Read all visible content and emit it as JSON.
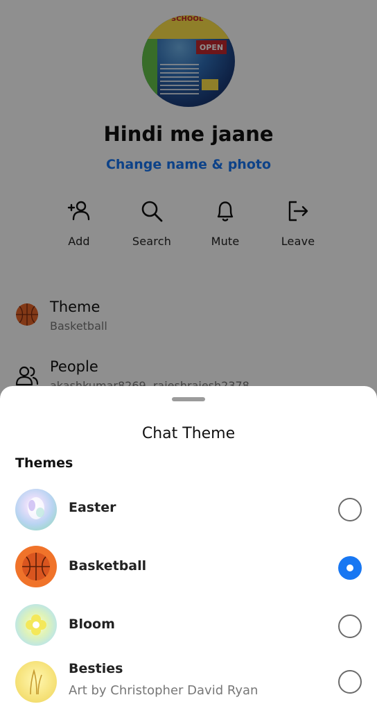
{
  "group": {
    "name": "Hindi me jaane",
    "change_link": "Change name & photo",
    "avatar_text": {
      "school": "SCHOOL",
      "open": "OPEN"
    }
  },
  "actions": [
    {
      "label": "Add",
      "icon": "add-person-icon"
    },
    {
      "label": "Search",
      "icon": "search-icon"
    },
    {
      "label": "Mute",
      "icon": "bell-icon"
    },
    {
      "label": "Leave",
      "icon": "leave-icon"
    }
  ],
  "settings": {
    "theme": {
      "title": "Theme",
      "value": "Basketball"
    },
    "people": {
      "title": "People",
      "value": "akashkumar8269, rajeshrajesh2378"
    }
  },
  "sheet": {
    "title": "Chat Theme",
    "section": "Themes",
    "themes": [
      {
        "name": "Easter",
        "subtitle": "",
        "selected": false
      },
      {
        "name": "Basketball",
        "subtitle": "",
        "selected": true
      },
      {
        "name": "Bloom",
        "subtitle": "",
        "selected": false
      },
      {
        "name": "Besties",
        "subtitle": "Art by Christopher David Ryan",
        "selected": false
      }
    ]
  },
  "colors": {
    "accent": "#1877f2",
    "basketball": "#e8672a",
    "scrim": "rgba(0,0,0,0.44)"
  }
}
